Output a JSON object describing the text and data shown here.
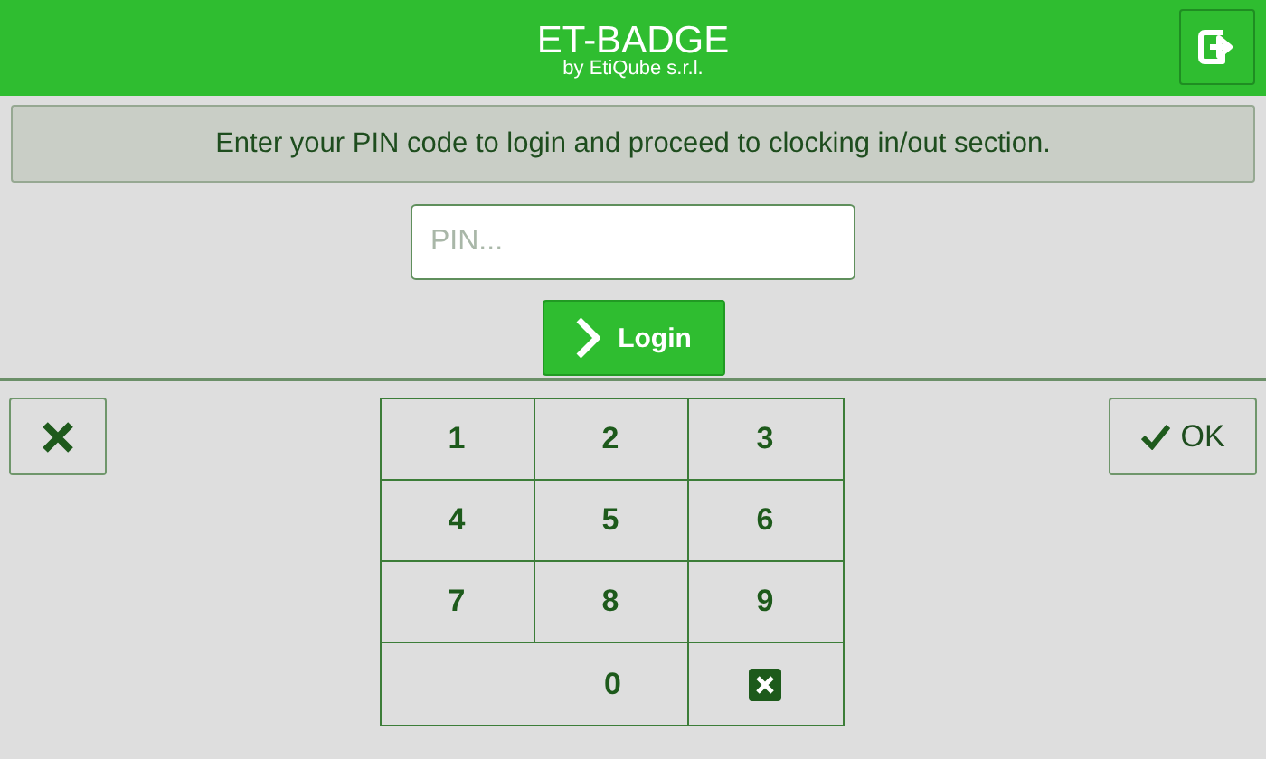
{
  "header": {
    "title": "ET-BADGE",
    "subtitle": "by EtiQube s.r.l."
  },
  "message": "Enter your PIN code to login and proceed to clocking in/out section.",
  "pin_field": {
    "placeholder": "PIN..."
  },
  "login_button": {
    "label": "Login"
  },
  "ok_button": {
    "label": "OK"
  },
  "keypad": [
    {
      "kind": "digit",
      "label": "1"
    },
    {
      "kind": "digit",
      "label": "2"
    },
    {
      "kind": "digit",
      "label": "3"
    },
    {
      "kind": "digit",
      "label": "4"
    },
    {
      "kind": "digit",
      "label": "5"
    },
    {
      "kind": "digit",
      "label": "6"
    },
    {
      "kind": "digit",
      "label": "7"
    },
    {
      "kind": "digit",
      "label": "8"
    },
    {
      "kind": "digit",
      "label": "9"
    },
    {
      "kind": "wide",
      "label": "0"
    },
    {
      "kind": "delete"
    }
  ]
}
